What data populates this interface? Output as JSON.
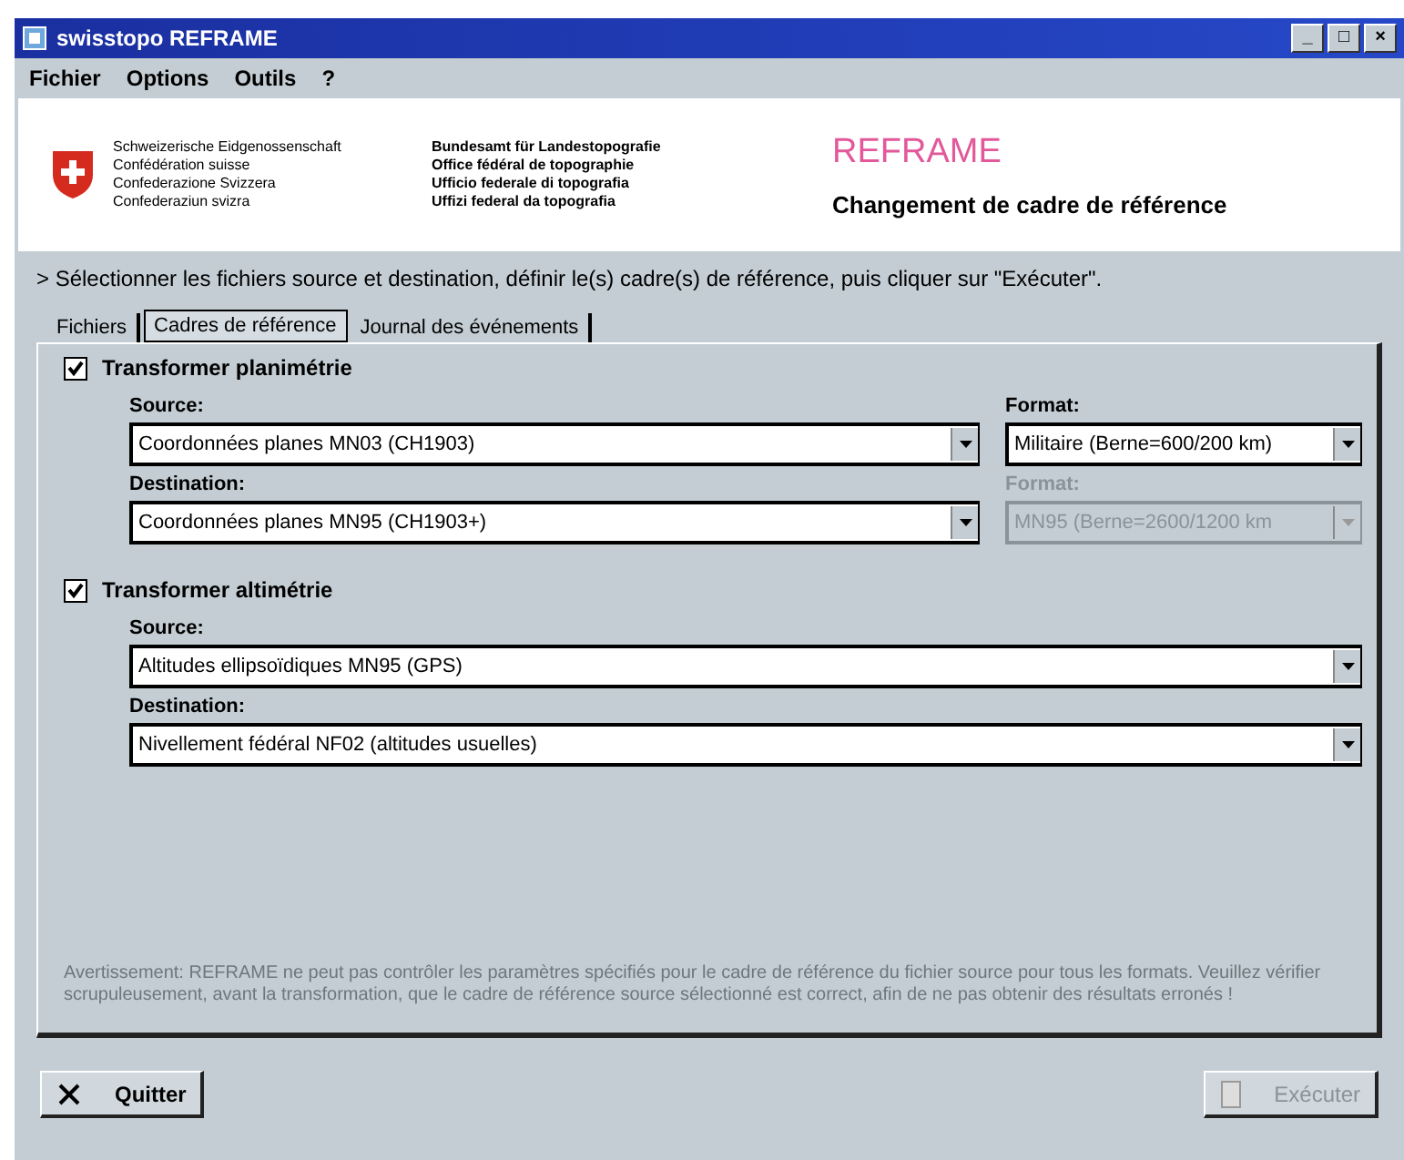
{
  "window": {
    "title": "swisstopo REFRAME",
    "controls": [
      "_",
      "□",
      "×"
    ]
  },
  "menu": [
    {
      "label": "Fichier"
    },
    {
      "label": "Options"
    },
    {
      "label": "Outils"
    },
    {
      "label": "?"
    }
  ],
  "header": {
    "federal_lines": [
      "Schweizerische Eidgenossenschaft",
      "Confédération suisse",
      "Confederazione Svizzera",
      "Confederaziun svizra"
    ],
    "office_lines": [
      "Bundesamt für Landestopografie",
      "Office fédéral de topographie",
      "Ufficio federale di topografia",
      "Uffizi federal da topografia"
    ],
    "app_name": "REFRAME",
    "subtitle": "Changement de cadre de référence"
  },
  "instruction": "> Sélectionner les fichiers source et destination, définir le(s) cadre(s) de référence, puis cliquer sur \"Exécuter\".",
  "tabs": [
    {
      "label": "Fichiers",
      "selected": false
    },
    {
      "label": "Cadres de référence",
      "selected": true
    },
    {
      "label": "Journal des événements",
      "selected": false
    }
  ],
  "sections": [
    {
      "label": "Transformer planimétrie",
      "checked": true,
      "rows": [
        {
          "label": "Source:",
          "value": "Coordonnées planes MN03 (CH1903)",
          "format_label": "Format:",
          "format_value": "Militaire (Berne=600/200 km)",
          "format_disabled": false
        },
        {
          "label": "Destination:",
          "value": "Coordonnées planes MN95 (CH1903+)",
          "format_label": "Format:",
          "format_value": "MN95 (Berne=2600/1200 km",
          "format_disabled": true
        }
      ]
    },
    {
      "label": "Transformer altimétrie",
      "checked": true,
      "rows": [
        {
          "label": "Source:",
          "value": "Altitudes ellipsoïdiques MN95 (GPS)"
        },
        {
          "label": "Destination:",
          "value": "Nivellement fédéral NF02 (altitudes usuelles)"
        }
      ]
    }
  ],
  "warning": "Avertissement: REFRAME ne peut pas contrôler les paramètres spécifiés pour le cadre de référence du fichier source pour tous les formats. Veuillez vérifier scrupuleusement, avant la transformation, que le cadre de référence source sélectionné est correct, afin de ne pas obtenir des résultats erronés !",
  "buttons": [
    {
      "label": "Quitter",
      "kind": "quit",
      "disabled": false
    },
    {
      "label": "Exécuter",
      "kind": "run",
      "disabled": true
    }
  ]
}
